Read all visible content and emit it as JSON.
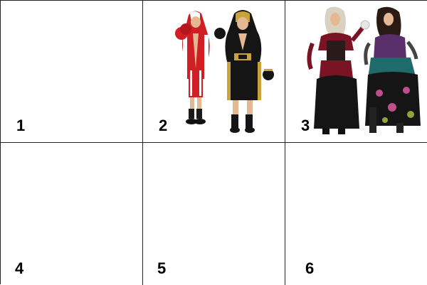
{
  "cells": [
    {
      "label": "1",
      "content": "empty"
    },
    {
      "label": "2",
      "content": "boxer-costumes"
    },
    {
      "label": "3",
      "content": "gypsy-costumes"
    },
    {
      "label": "4",
      "content": "empty"
    },
    {
      "label": "5",
      "content": "empty"
    },
    {
      "label": "6",
      "content": "empty"
    }
  ],
  "colors": {
    "grid_line": "#222222",
    "boxer_red": "#d01e25",
    "boxer_black": "#151515",
    "gold_trim": "#c9a23a",
    "gypsy_burgundy": "#7a1424",
    "gypsy_purple": "#5a2e6b"
  }
}
